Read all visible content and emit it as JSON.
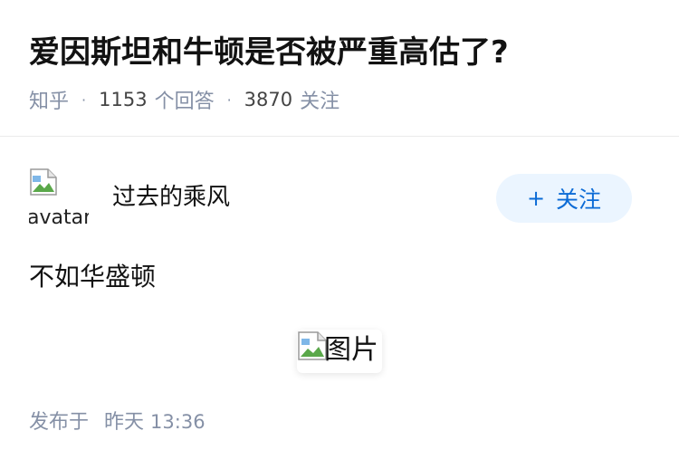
{
  "question": {
    "title": "爱因斯坦和牛顿是否被严重高估了?",
    "source": "知乎",
    "separator": "·",
    "answers_count": "1153",
    "answers_label": "个回答",
    "followers_count": "3870",
    "followers_label": "关注"
  },
  "answer": {
    "author": {
      "name": "过去的乘风",
      "avatar_alt": "avatar"
    },
    "follow_button": {
      "icon": "+",
      "label": "关注"
    },
    "text": "不如华盛顿",
    "image_alt": "图片",
    "publish": {
      "prefix": "发布于",
      "day": "昨天",
      "time": "13:36"
    }
  },
  "colors": {
    "title": "#121212",
    "meta_gray": "#8590a6",
    "accent_blue": "#0b6bd6",
    "follow_bg": "#ebf5ff",
    "divider": "#ebebeb"
  },
  "icons": {
    "broken_image": "broken-image-icon",
    "plus": "plus-icon"
  }
}
